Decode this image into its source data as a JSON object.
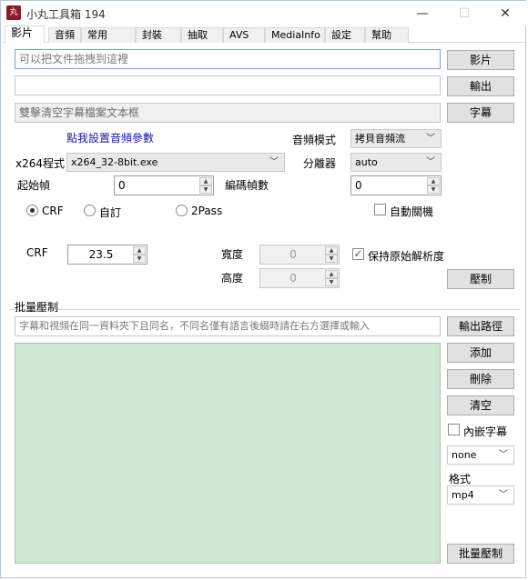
{
  "window": {
    "title": "小丸工具箱 194",
    "app_icon_text": "丸",
    "minimize": "—",
    "maximize": "☐",
    "close": "✕"
  },
  "tabs": [
    "影片",
    "音頻",
    "常用",
    "封裝",
    "抽取",
    "AVS",
    "MediaInfo",
    "設定",
    "幫助"
  ],
  "files": {
    "video_input_placeholder": "可以把文件拖拽到這裡",
    "video_button": "影片",
    "output_value": "",
    "output_button": "輸出",
    "subtitle_placeholder": "雙擊清空字幕檔案文本框",
    "subtitle_button": "字幕"
  },
  "settings": {
    "audio_param_link": "點我設置音頻參數",
    "audio_mode_label": "音頻模式",
    "audio_mode_value": "拷貝音頻流",
    "x264_label": "x264程式",
    "x264_value": "x264_32-8bit.exe",
    "splitter_label": "分離器",
    "splitter_value": "auto",
    "start_frame_label": "起始幀",
    "start_frame_value": "0",
    "encode_frames_label": "編碼幀數",
    "encode_frames_value": "0",
    "mode_crf": "CRF",
    "mode_custom": "自訂",
    "mode_2pass": "2Pass",
    "auto_shutdown": "自動關機",
    "crf_label": "CRF",
    "crf_value": "23.5",
    "width_label": "寬度",
    "width_value": "0",
    "height_label": "高度",
    "height_value": "0",
    "keep_resolution": "保持原始解析度",
    "keep_resolution_mark": "✓",
    "encode_button": "壓制"
  },
  "batch": {
    "section_label": "批量壓制",
    "hint": "字幕和視頻在同一資料夾下且同名，不同名僅有語言後綴時請在右方選擇或輸入",
    "output_path_button": "輸出路徑",
    "add_button": "添加",
    "delete_button": "刪除",
    "clear_button": "清空",
    "embed_subtitle": "內嵌字幕",
    "subtitle_option": "none",
    "format_label": "格式",
    "format_value": "mp4",
    "batch_encode_button": "批量壓制"
  }
}
